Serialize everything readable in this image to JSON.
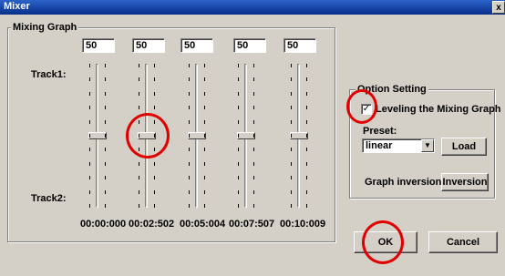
{
  "window": {
    "title": "Mixer",
    "close_label": "x"
  },
  "mixing_graph": {
    "group_label": "Mixing Graph",
    "values": [
      "50",
      "50",
      "50",
      "50",
      "50"
    ],
    "track1_label": "Track1:",
    "track2_label": "Track2:",
    "slider_levels": [
      0.5,
      0.5,
      0.5,
      0.5,
      0.5
    ],
    "times": [
      "00:00:000",
      "00:02:502",
      "00:05:004",
      "00:07:507",
      "00:10:009"
    ]
  },
  "option_setting": {
    "group_label": "Option Setting",
    "checkbox_label": "Leveling the Mixing Graph",
    "checkbox_checked": "✓",
    "preset_label": "Preset:",
    "preset_value": "linear",
    "load_label": "Load",
    "graph_inversion_label": "Graph inversion",
    "inversion_button_label": "Inversion"
  },
  "buttons": {
    "ok_label": "OK",
    "cancel_label": "Cancel"
  },
  "annotations": {
    "circle_color": "#e00000"
  }
}
